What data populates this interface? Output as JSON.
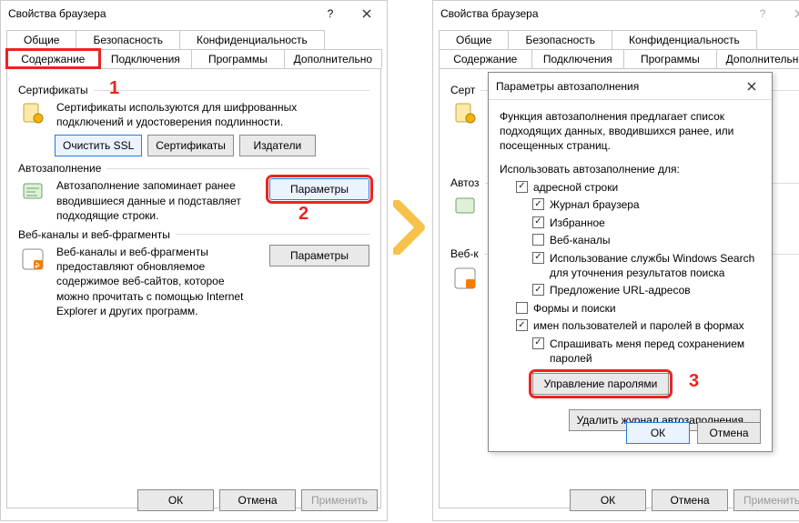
{
  "annotations": {
    "one": "1",
    "two": "2",
    "three": "3"
  },
  "left_dialog": {
    "title": "Свойства браузера",
    "tabs_row1": [
      "Общие",
      "Безопасность",
      "Конфиденциальность"
    ],
    "tabs_row2": [
      "Содержание",
      "Подключения",
      "Программы",
      "Дополнительно"
    ],
    "active_tab": "Содержание",
    "cert": {
      "title": "Сертификаты",
      "desc": "Сертификаты используются для шифрованных подключений и удостоверения подлинности.",
      "btn_ssl": "Очистить SSL",
      "btn_cert": "Сертификаты",
      "btn_pub": "Издатели"
    },
    "auto": {
      "title": "Автозаполнение",
      "desc": "Автозаполнение запоминает ранее вводившиеся данные и подставляет подходящие строки.",
      "btn_params": "Параметры"
    },
    "feeds": {
      "title": "Веб-каналы и веб-фрагменты",
      "desc": "Веб-каналы и веб-фрагменты предоставляют обновляемое содержимое веб-сайтов, которое можно прочитать с помощью Internet Explorer и других программ.",
      "btn_params": "Параметры"
    },
    "bottom": {
      "ok": "ОК",
      "cancel": "Отмена",
      "apply": "Применить"
    }
  },
  "right_dialog": {
    "title": "Свойства браузера",
    "tabs_row1": [
      "Общие",
      "Безопасность",
      "Конфиденциальность"
    ],
    "tabs_row2": [
      "Содержание",
      "Подключения",
      "Программы",
      "Дополнительно"
    ],
    "sections": {
      "cert_title": "Серт",
      "auto_title": "Автоз",
      "feeds_title": "Веб-к"
    },
    "bottom": {
      "ok": "ОК",
      "cancel": "Отмена",
      "apply": "Применить"
    }
  },
  "sub_dialog": {
    "title": "Параметры автозаполнения",
    "intro": "Функция автозаполнения предлагает список подходящих данных, вводившихся ранее, или посещенных страниц.",
    "use_label": "Использовать автозаполнение для:",
    "items": {
      "address_bar": {
        "label": "адресной строки",
        "checked": true
      },
      "history": {
        "label": "Журнал браузера",
        "checked": true
      },
      "favorites": {
        "label": "Избранное",
        "checked": true
      },
      "feeds": {
        "label": "Веб-каналы",
        "checked": false
      },
      "wsearch": {
        "label": "Использование службы Windows Search для уточнения результатов поиска",
        "checked": true
      },
      "url_suggest": {
        "label": "Предложение URL-адресов",
        "checked": true
      },
      "forms": {
        "label": "Формы и поиски",
        "checked": false
      },
      "userpass": {
        "label": "имен пользователей и паролей в формах",
        "checked": true
      },
      "ask_save": {
        "label": "Спрашивать меня перед сохранением паролей",
        "checked": true
      }
    },
    "btn_manage_pw": "Управление паролями",
    "btn_del_hist": "Удалить журнал автозаполнения...",
    "ok": "ОК",
    "cancel": "Отмена"
  }
}
